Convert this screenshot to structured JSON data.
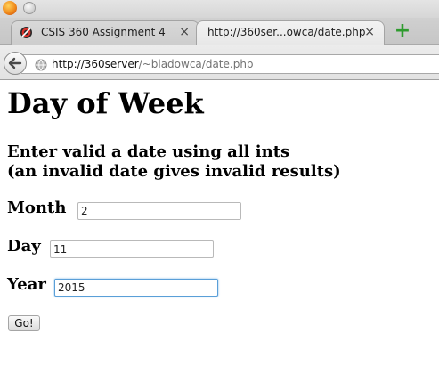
{
  "browser": {
    "tabs": [
      {
        "label": "CSIS 360 Assignment 4",
        "active": false
      },
      {
        "label": "http://360ser...owca/date.php",
        "active": true
      }
    ],
    "url": {
      "host": "http://360server",
      "path": "/~bladowca/date.php"
    },
    "close_glyph": "×",
    "newtab_glyph": "+",
    "back_glyph": "←"
  },
  "page": {
    "title": "Day of Week",
    "instruction_line1": "Enter valid a date using all ints",
    "instruction_line2": "(an invalid date gives invalid results)",
    "fields": {
      "month": {
        "label": "Month",
        "value": "2"
      },
      "day": {
        "label": "Day",
        "value": "11"
      },
      "year": {
        "label": "Year",
        "value": "2015"
      }
    },
    "submit_label": "Go!"
  },
  "colors": {
    "focus_border": "#5a9fd8",
    "newtab_accent": "#2e9b2e",
    "browser_logo": "#f08a1c"
  }
}
